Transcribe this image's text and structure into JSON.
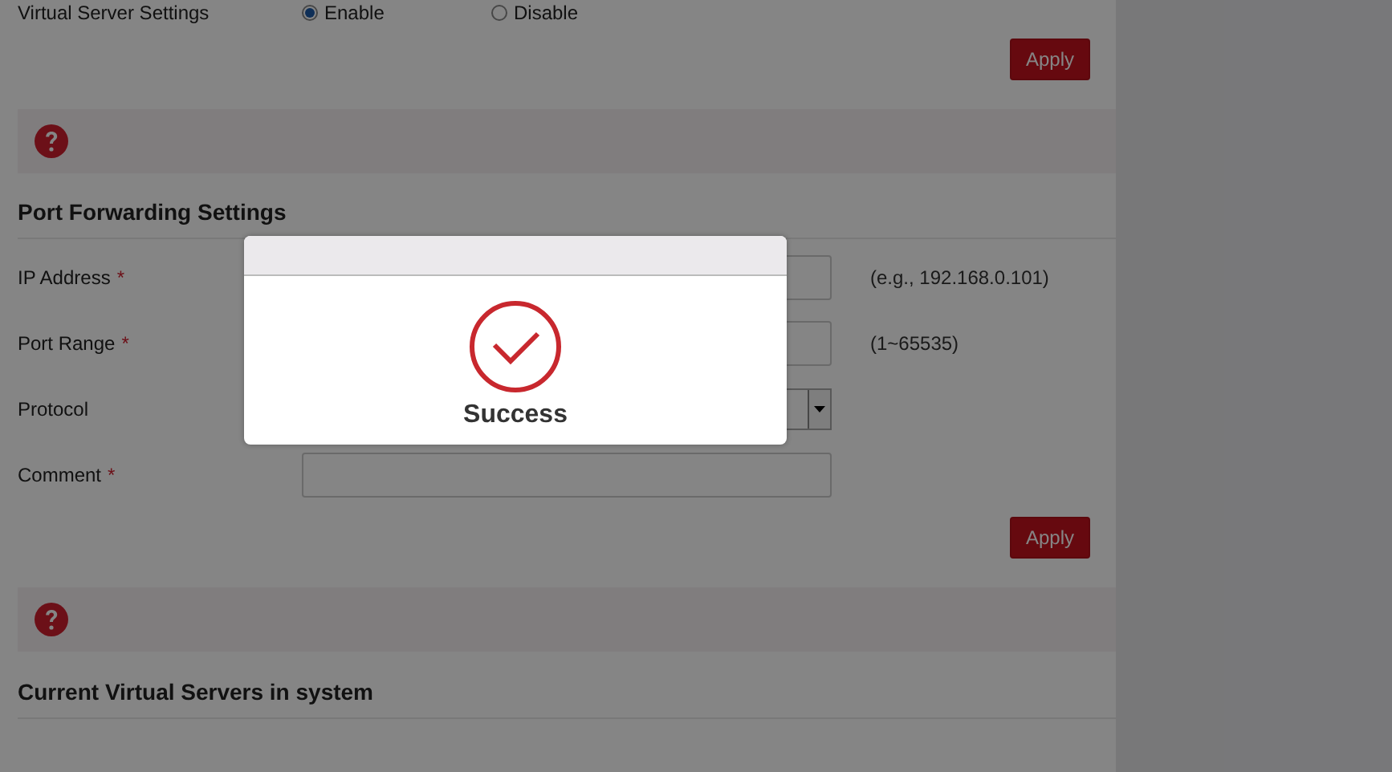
{
  "virtual_server": {
    "label": "Virtual Server Settings",
    "options": [
      {
        "label": "Enable",
        "selected": true
      },
      {
        "label": "Disable",
        "selected": false
      }
    ],
    "apply": "Apply"
  },
  "port_forwarding": {
    "title": "Port Forwarding Settings",
    "fields": [
      {
        "label": "IP Address",
        "required_mark": "*",
        "kind": "text",
        "hint": "(e.g., 192.168.0.101)"
      },
      {
        "label": "Port Range",
        "required_mark": "*",
        "kind": "text",
        "hint": "(1~65535)"
      },
      {
        "label": "Protocol",
        "kind": "select"
      },
      {
        "label": "Comment",
        "required_mark": "*",
        "kind": "text"
      }
    ],
    "apply": "Apply"
  },
  "current_servers": {
    "title": "Current Virtual Servers in system"
  },
  "dialog": {
    "message": "Success"
  }
}
